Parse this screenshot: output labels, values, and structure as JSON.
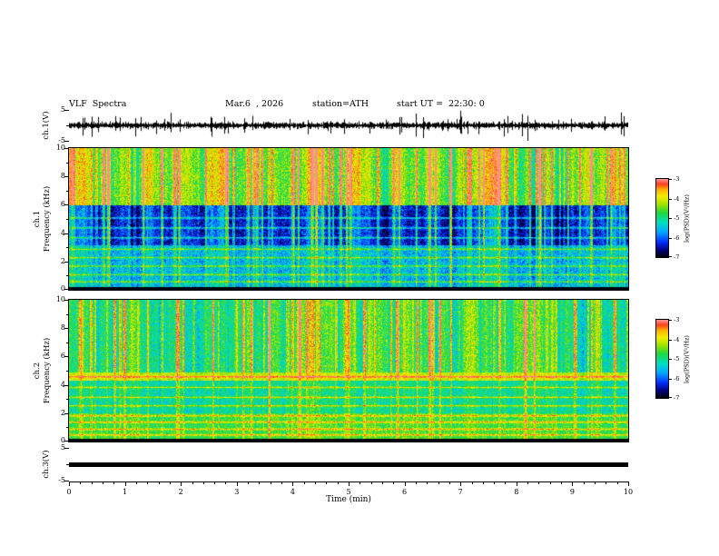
{
  "header": {
    "title": "VLF  Spectra",
    "date": "Mar.6  , 2026",
    "station": "station=ATH",
    "start_ut": "start UT =  22:30: 0"
  },
  "axes": {
    "x": {
      "label": "Time (min)",
      "min": 0,
      "max": 10,
      "major_ticks": [
        0,
        1,
        2,
        3,
        4,
        5,
        6,
        7,
        8,
        9,
        10
      ],
      "minor_step": 0.2
    },
    "wave1": {
      "label": "ch.1(V)",
      "min": -5,
      "max": 5,
      "tick_labels": [
        "5",
        "-5"
      ]
    },
    "spec1": {
      "label_line1": "ch.1",
      "label_line2": "Frequency (kHz)",
      "min": 0,
      "max": 10,
      "ticks": [
        0,
        2,
        4,
        6,
        8,
        10
      ]
    },
    "spec2": {
      "label_line1": "ch.2",
      "label_line2": "Frequency (kHz)",
      "min": 0,
      "max": 10,
      "ticks": [
        0,
        2,
        4,
        6,
        8,
        10
      ]
    },
    "wave3": {
      "label": "ch.3(V)",
      "min": -5,
      "max": 5,
      "tick_labels": [
        "5",
        "-5"
      ]
    }
  },
  "colorbars": [
    {
      "label": "log(PSD)(V²/Hz)",
      "min": -7,
      "max": -3,
      "ticks": [
        -3,
        -4,
        -5,
        -6,
        -7
      ]
    },
    {
      "label": "log(PSD)(V²/Hz)",
      "min": -7,
      "max": -3,
      "ticks": [
        -3,
        -4,
        -5,
        -6,
        -7
      ]
    }
  ],
  "colormap": {
    "stops": [
      [
        0,
        "#000000"
      ],
      [
        0.1,
        "#000080"
      ],
      [
        0.2,
        "#0030ff"
      ],
      [
        0.33,
        "#00aaff"
      ],
      [
        0.45,
        "#00e0c0"
      ],
      [
        0.57,
        "#20d840"
      ],
      [
        0.68,
        "#a0e400"
      ],
      [
        0.78,
        "#f2ee00"
      ],
      [
        0.87,
        "#ffb000"
      ],
      [
        0.94,
        "#ff4020"
      ],
      [
        1,
        "#ff9090"
      ]
    ]
  },
  "chart_data": [
    {
      "type": "line",
      "name": "ch1_waveform",
      "title": "ch.1(V) time series",
      "x_range_min": [
        0,
        10
      ],
      "y_range_V": [
        -5,
        5
      ],
      "description": "black broadband noise trace around 0 V (~±1 V) with dense impulsive sferic spikes reaching ±5 V across the whole 10 minutes",
      "noise_amp_V": 1.0,
      "spike_rate": 0.12,
      "spike_amp_V": 4.5,
      "seed": 11
    },
    {
      "type": "heatmap",
      "name": "ch1_spectrogram",
      "x_range_min": [
        0,
        10
      ],
      "y_range_kHz": [
        0,
        10
      ],
      "z_range": [
        -7,
        -3
      ],
      "z_label": "log(PSD)(V²/Hz)",
      "seed": 23,
      "bands": [
        {
          "f_kHz": [
            0,
            0.25
          ],
          "base": -7.0,
          "noise": 0.15,
          "streak": 0.0,
          "hlines": []
        },
        {
          "f_kHz": [
            0.25,
            3.2
          ],
          "base": -5.5,
          "noise": 0.55,
          "streak": 0.45,
          "hlines": [
            0.6,
            1.1,
            1.7,
            2.3,
            2.9
          ]
        },
        {
          "f_kHz": [
            3.2,
            6.0
          ],
          "base": -6.25,
          "noise": 0.45,
          "streak": 0.85,
          "hlines": [
            3.7,
            4.4,
            5.1
          ]
        },
        {
          "f_kHz": [
            6.0,
            10.0
          ],
          "base": -4.35,
          "noise": 0.5,
          "streak": 1.1,
          "hlines": []
        }
      ],
      "description": "dense vertical sferic streaks; quiet dark-blue band 3-6 kHz with faint horizontal lines; strong green/yellow power with red vertical streaks above 6 kHz; black band below 0.25 kHz"
    },
    {
      "type": "heatmap",
      "name": "ch2_spectrogram",
      "x_range_min": [
        0,
        10
      ],
      "y_range_kHz": [
        0,
        10
      ],
      "z_range": [
        -7,
        -3
      ],
      "z_label": "log(PSD)(V²/Hz)",
      "seed": 57,
      "bands": [
        {
          "f_kHz": [
            0,
            0.2
          ],
          "base": -7.0,
          "noise": 0.15,
          "streak": 0.0,
          "hlines": []
        },
        {
          "f_kHz": [
            0.2,
            2.05
          ],
          "base": -4.65,
          "noise": 0.4,
          "streak": 0.35,
          "hlines": [
            0.5,
            0.9,
            1.4,
            1.85
          ]
        },
        {
          "f_kHz": [
            2.05,
            4.35
          ],
          "base": -5.05,
          "noise": 0.45,
          "streak": 0.4,
          "hlines": [
            2.55,
            3.15,
            3.85
          ]
        },
        {
          "f_kHz": [
            4.35,
            4.9
          ],
          "base": -4.1,
          "noise": 0.35,
          "streak": 0.35,
          "hlines": [
            4.6
          ]
        },
        {
          "f_kHz": [
            4.9,
            10.0
          ],
          "base": -4.75,
          "noise": 0.5,
          "streak": 1.0,
          "hlines": []
        }
      ],
      "description": "green background with yellow/red vertical streaks above 5 kHz; bright yellow-orange horizontal bands near 0.5-2 kHz and 4.5 kHz; black band below 0.2 kHz"
    },
    {
      "type": "line",
      "name": "ch3_waveform",
      "title": "ch.3(V) time series",
      "x_range_min": [
        0,
        10
      ],
      "y_range_V": [
        -5,
        5
      ],
      "description": "flat thick black trace at 0 V (channel flat/saturated)",
      "flat_value_V": 0
    }
  ]
}
